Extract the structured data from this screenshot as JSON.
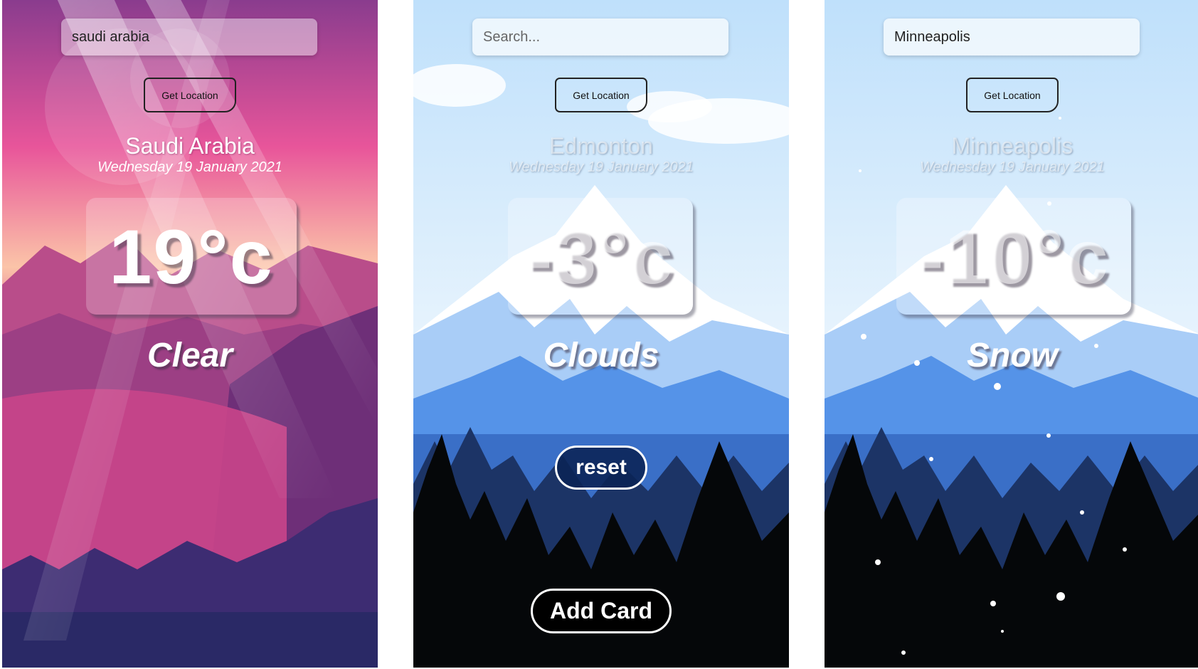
{
  "cards": [
    {
      "search": {
        "value": "saudi arabia",
        "placeholder": ""
      },
      "location_button": "Get Location",
      "city": "Saudi Arabia",
      "date": "Wednesday 19 January 2021",
      "temperature": "19°c",
      "condition": "Clear",
      "theme": "sunset",
      "colors": {
        "sky_top": "#8a3c8e",
        "sky_mid": "#e8559a",
        "horizon": "#fbc4a8",
        "mountain": "#a1407e",
        "ground": "#2a2966"
      }
    },
    {
      "search": {
        "value": "",
        "placeholder": "Search..."
      },
      "location_button": "Get Location",
      "city": "Edmonton",
      "date": "Wednesday 19 January 2021",
      "temperature": "-3°c",
      "condition": "Clouds",
      "reset_button": "reset",
      "add_card_button": "Add Card",
      "theme": "winter-day",
      "colors": {
        "sky": "#d8ecfb",
        "snow": "#ffffff",
        "mountain_light": "#a9cdf7",
        "mountain_blue": "#5593e8",
        "forest": "#1c3466",
        "trees": "#050709"
      }
    },
    {
      "search": {
        "value": "Minneapolis",
        "placeholder": ""
      },
      "location_button": "Get Location",
      "city": "Minneapolis",
      "date": "Wednesday 19 January 2021",
      "temperature": "-10°c",
      "condition": "Snow",
      "theme": "winter-snow",
      "colors": {
        "sky": "#d8ecfb",
        "snow": "#ffffff",
        "mountain_light": "#a9cdf7",
        "mountain_blue": "#5593e8",
        "forest": "#1c3466",
        "trees": "#050709"
      }
    }
  ]
}
